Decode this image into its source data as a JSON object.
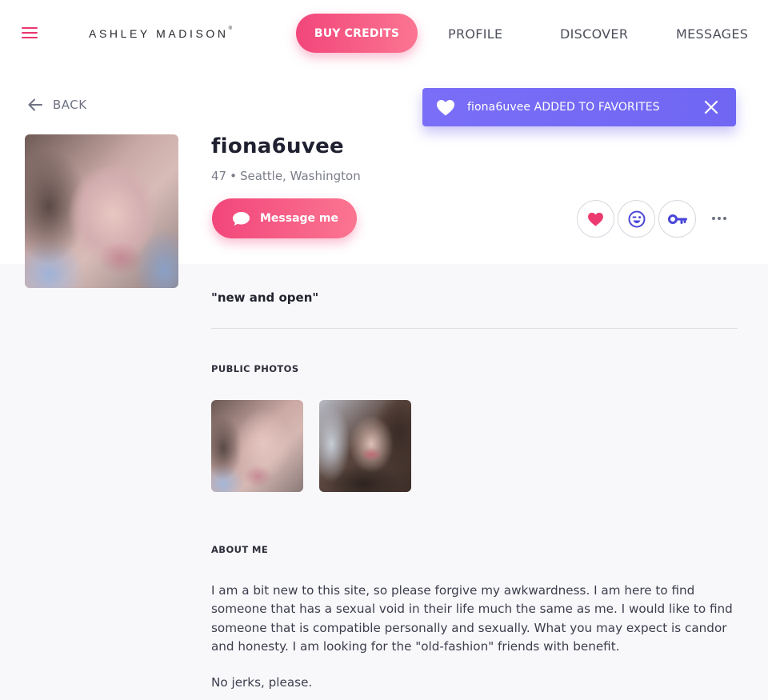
{
  "header": {
    "logo": "ASHLEY MADISON",
    "logo_mark": "®",
    "buy_credits": "BUY CREDITS",
    "nav": [
      "PROFILE",
      "DISCOVER",
      "MESSAGES"
    ]
  },
  "back_label": "BACK",
  "toast": {
    "text": "fiona6uvee ADDED TO FAVORITES",
    "icon": "heart-icon",
    "close_icon": "close-icon"
  },
  "profile": {
    "username": "fiona6uvee",
    "age": "47",
    "separator": "•",
    "location": "Seattle, Washington",
    "message_button": "Message me",
    "tagline": "\"new and open\"",
    "actions": [
      "heart-icon",
      "wink-icon",
      "key-icon",
      "more-icon"
    ]
  },
  "sections": {
    "public_photos": "PUBLIC PHOTOS",
    "about_me": "ABOUT ME"
  },
  "about": {
    "paragraph1": "I am a bit new to this site, so please forgive my awkwardness. I am here to find someone that has a sexual void in their life much the same as me. I would like to find someone that is compatible personally and sexually. What you may expect is candor and honesty. I am looking for the \"old-fashion\" friends with benefit.",
    "paragraph2": "No jerks, please."
  },
  "colors": {
    "accent_pink": "#f2467b",
    "toast_purple": "#7a6ef8",
    "icon_blue": "#4a46d8"
  }
}
